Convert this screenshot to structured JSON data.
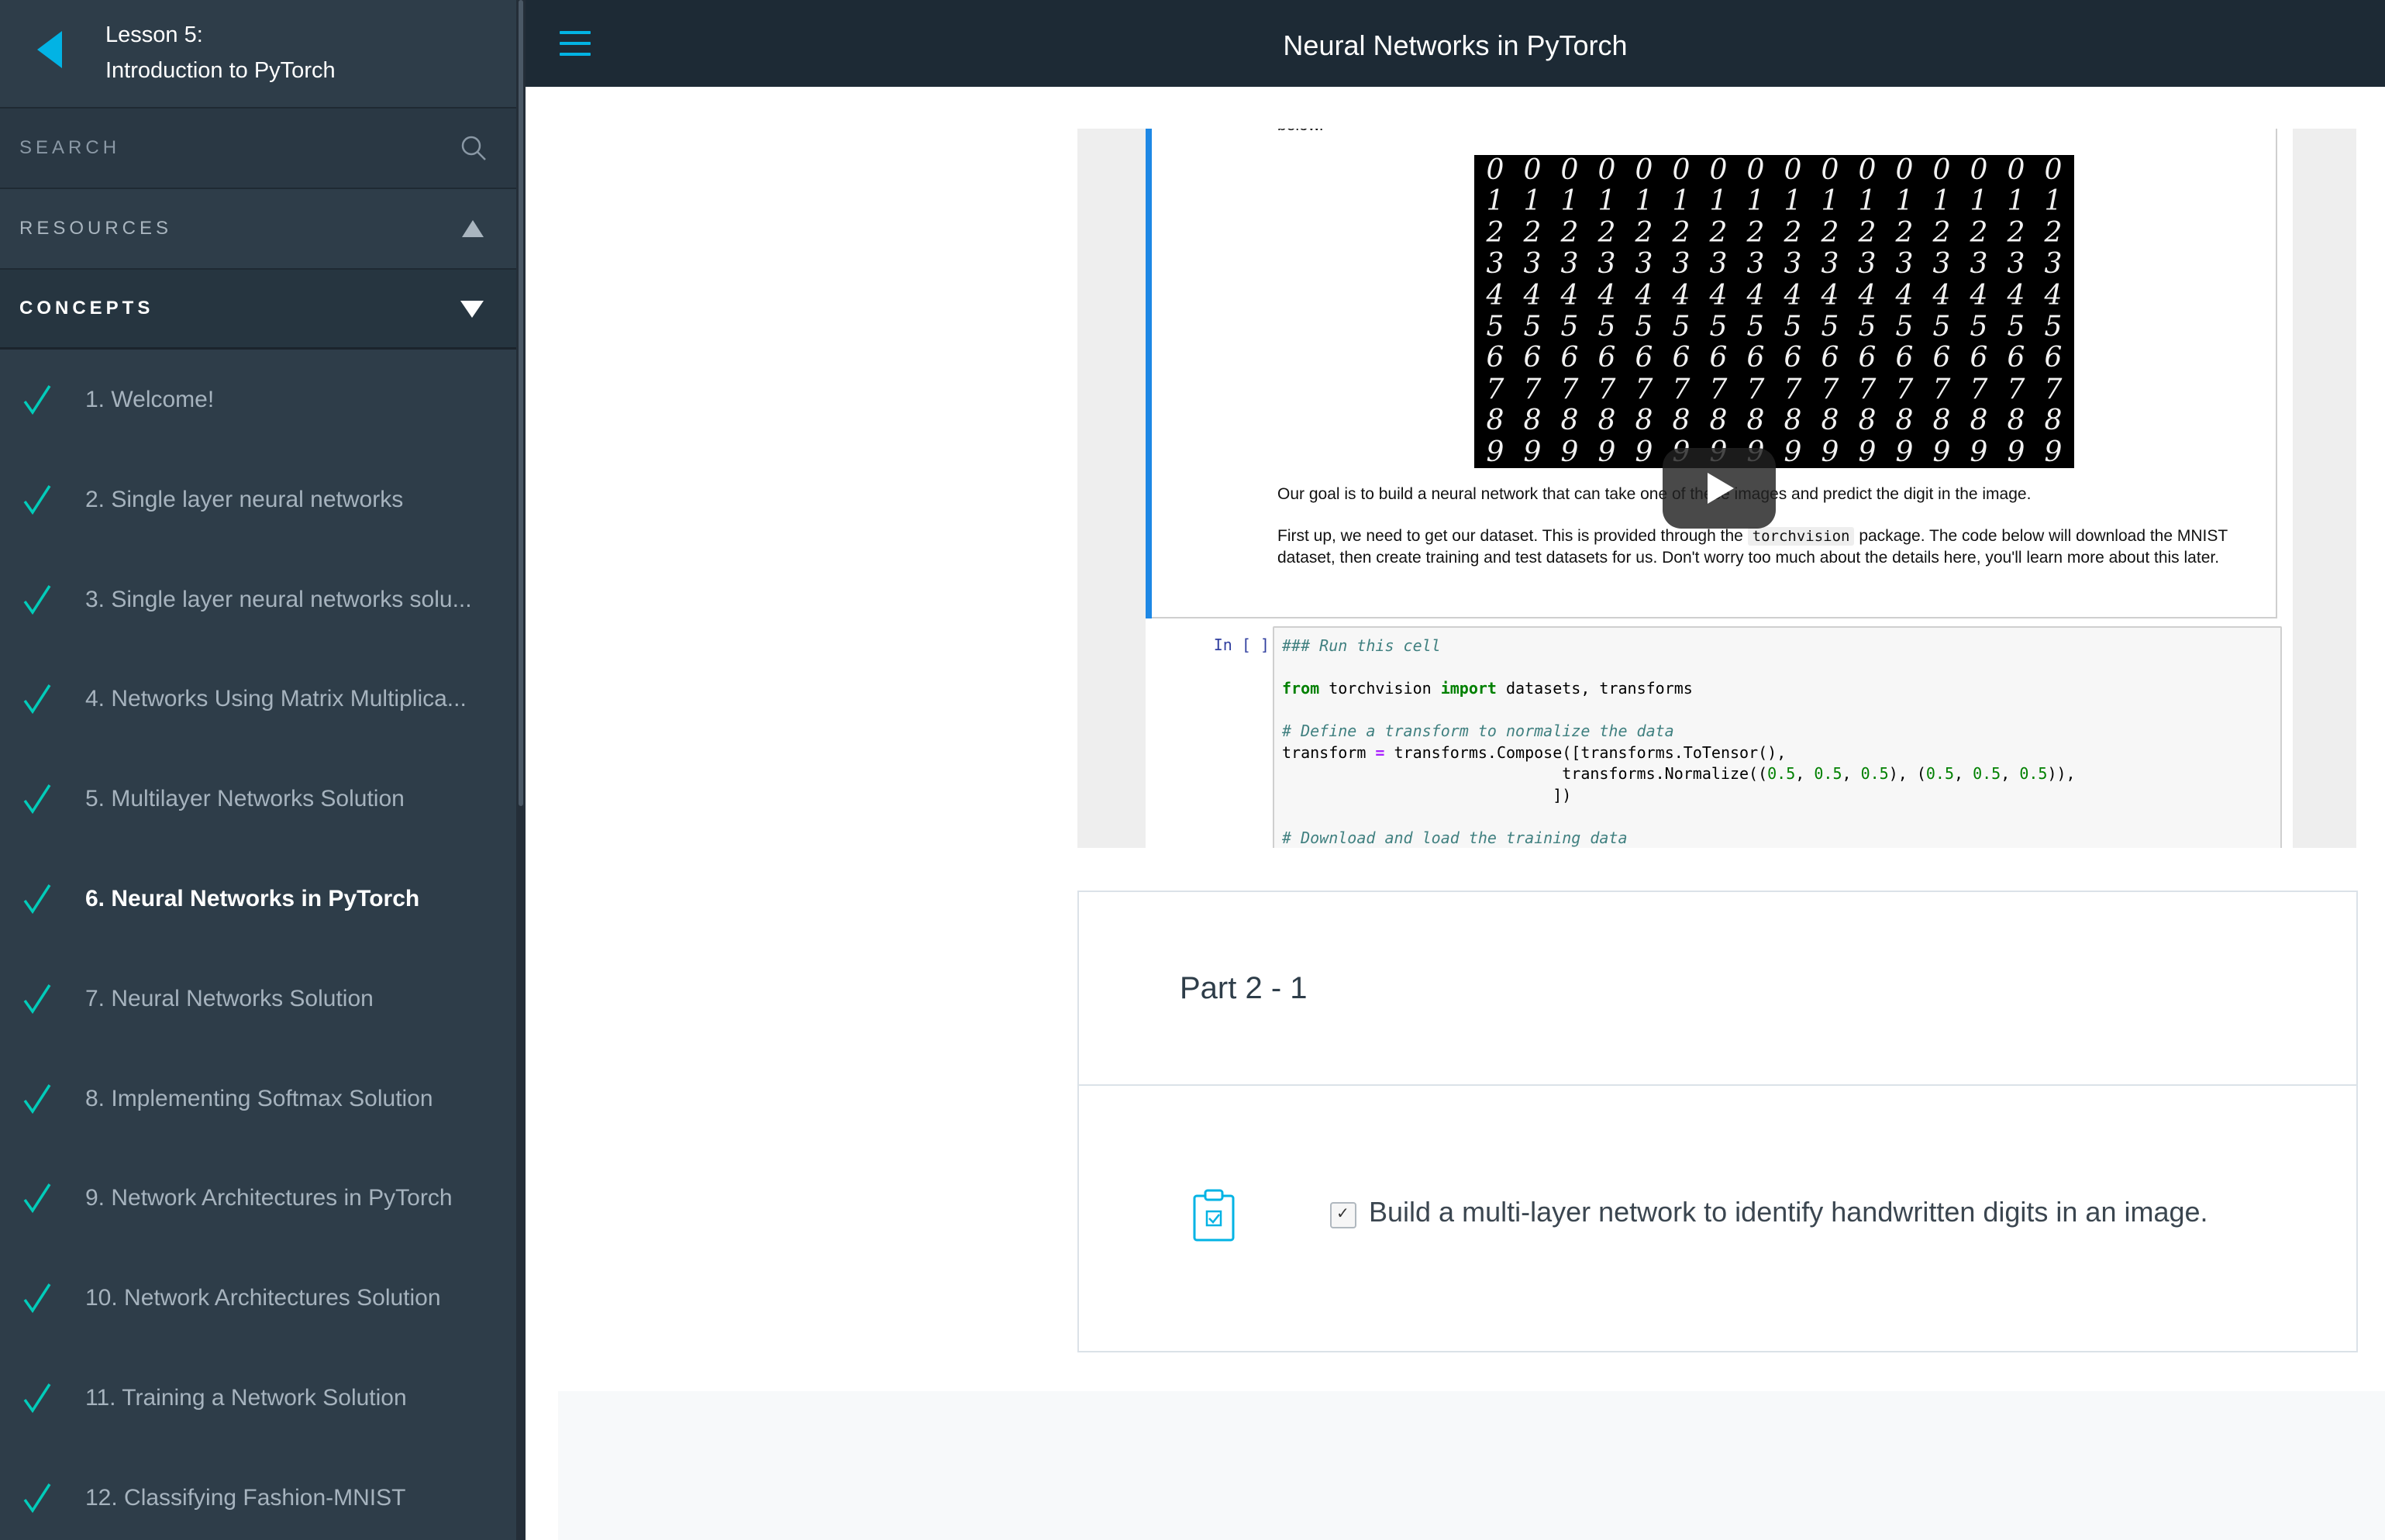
{
  "lesson": {
    "line1": "Lesson 5:",
    "line2": "Introduction to PyTorch"
  },
  "sidebar": {
    "search_label": "SEARCH",
    "resources_label": "RESOURCES",
    "concepts_label": "CONCEPTS",
    "concepts": [
      {
        "label": "1. Welcome!",
        "completed": true
      },
      {
        "label": "2. Single layer neural networks",
        "completed": true
      },
      {
        "label": "3. Single layer neural networks solu...",
        "completed": true
      },
      {
        "label": "4. Networks Using Matrix Multiplica...",
        "completed": true
      },
      {
        "label": "5. Multilayer Networks Solution",
        "completed": true
      },
      {
        "label": "6. Neural Networks in PyTorch",
        "completed": true,
        "active": true
      },
      {
        "label": "7. Neural Networks Solution",
        "completed": true
      },
      {
        "label": "8. Implementing Softmax Solution",
        "completed": true
      },
      {
        "label": "9. Network Architectures in PyTorch",
        "completed": true
      },
      {
        "label": "10. Network Architectures Solution",
        "completed": true
      },
      {
        "label": "11. Training a Network Solution",
        "completed": true
      },
      {
        "label": "12. Classifying Fashion-MNIST",
        "completed": true
      }
    ]
  },
  "header": {
    "title": "Neural Networks in PyTorch"
  },
  "notebook": {
    "cut_text": "below.",
    "mnist_rows": [
      "0000000000000000",
      "1111111111111111",
      "2222222222222222",
      "3333333333333333",
      "4444444444444444",
      "5555555555555555",
      "6666666666666666",
      "7777777777777777",
      "8888888888888888",
      "9999999999999999"
    ],
    "para1": "Our goal is to build a neural network that can take one of these images and predict the digit in the image.",
    "para2_before": "First up, we need to get our dataset. This is provided through the ",
    "para2_code": "torchvision",
    "para2_after": " package. The code below will download the MNIST dataset, then create training and test datasets for us. Don't worry too much about the details here, you'll learn more about this later.",
    "in_prompt": "In [ ]:",
    "code": {
      "c1": "### Run this cell",
      "kw_from": "from",
      "mod": " torchvision ",
      "kw_import": "import",
      "imports": " datasets, transforms",
      "c2": "# Define a transform to normalize the data",
      "l1_a": "transform ",
      "op_eq": "=",
      "l1_b": " transforms.Compose([transforms.ToTensor(),",
      "l2_a": "                              transforms.Normalize((",
      "n1": "0.5",
      "sep": ", ",
      "l2_mid": "), (",
      "l2_end": ")),",
      "l3": "                             ])",
      "c3": "# Download and load the training data"
    }
  },
  "part": {
    "title": "Part 2 - 1",
    "task": "Build a multi-layer network to identify handwritten digits in an image."
  },
  "colors": {
    "accent": "#02b3e4",
    "sidebar_bg": "#2e3d49",
    "topbar_bg": "#1d2a35"
  }
}
